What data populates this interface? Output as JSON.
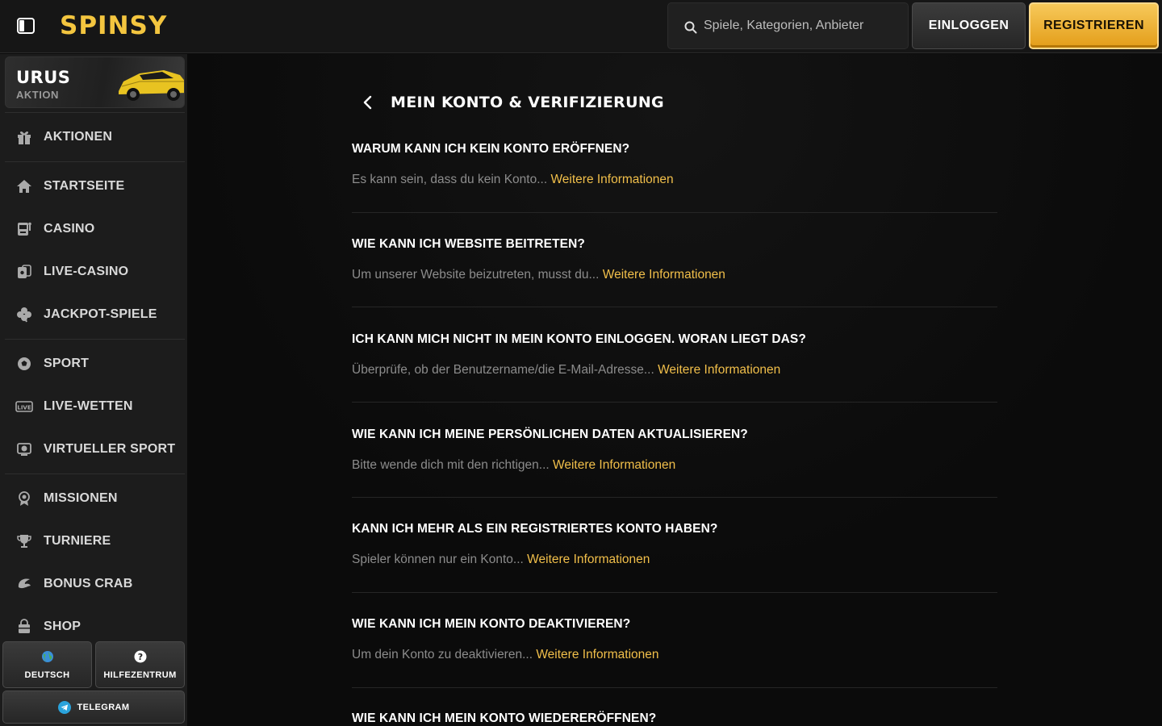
{
  "header": {
    "logo": "SPINSY",
    "search_placeholder": "Spiele, Kategorien, Anbieter",
    "login_label": "EINLOGGEN",
    "register_label": "REGISTRIEREN"
  },
  "sidebar": {
    "promo": {
      "title": "URUS",
      "subtitle": "AKTION"
    },
    "items": [
      {
        "label": "AKTIONEN",
        "icon": "gift-icon"
      },
      {
        "label": "STARTSEITE",
        "icon": "home-icon"
      },
      {
        "label": "CASINO",
        "icon": "slot-machine-icon"
      },
      {
        "label": "LIVE-CASINO",
        "icon": "cards-icon"
      },
      {
        "label": "JACKPOT-SPIELE",
        "icon": "clover-icon"
      },
      {
        "label": "SPORT",
        "icon": "soccer-ball-icon"
      },
      {
        "label": "LIVE-WETTEN",
        "icon": "live-badge-icon"
      },
      {
        "label": "VIRTUELLER SPORT",
        "icon": "virtual-sport-icon"
      },
      {
        "label": "MISSIONEN",
        "icon": "missions-icon"
      },
      {
        "label": "TURNIERE",
        "icon": "trophy-icon"
      },
      {
        "label": "BONUS CRAB",
        "icon": "crab-claw-icon"
      },
      {
        "label": "SHOP",
        "icon": "shop-bag-icon"
      }
    ],
    "language_label": "DEUTSCH",
    "help_label": "HILFEZENTRUM",
    "telegram_label": "TELEGRAM",
    "live_badge_text": "LIVE"
  },
  "main": {
    "title": "MEIN KONTO & VERIFIZIERUNG",
    "more_label": "Weitere Informationen",
    "faqs": [
      {
        "question": "WARUM KANN ICH KEIN KONTO ERÖFFNEN?",
        "answer": "Es kann sein, dass du kein Konto..."
      },
      {
        "question": "WIE KANN ICH WEBSITE BEITRETEN?",
        "answer": "Um unserer Website beizutreten, musst du..."
      },
      {
        "question": "ICH KANN MICH NICHT IN MEIN KONTO EINLOGGEN. WORAN LIEGT DAS?",
        "answer": "Überprüfe, ob der Benutzername/die E-Mail-Adresse..."
      },
      {
        "question": "WIE KANN ICH MEINE PERSÖNLICHEN DATEN AKTUALISIEREN?",
        "answer": "Bitte wende dich mit den richtigen..."
      },
      {
        "question": "KANN ICH MEHR ALS EIN REGISTRIERTES KONTO HABEN?",
        "answer": "Spieler können nur ein Konto..."
      },
      {
        "question": "WIE KANN ICH MEIN KONTO DEAKTIVIEREN?",
        "answer": "Um dein Konto zu deaktivieren..."
      },
      {
        "question": "WIE KANN ICH MEIN KONTO WIEDERERÖFFNEN?",
        "answer": ""
      }
    ]
  },
  "colors": {
    "accent": "#f3c53f",
    "link": "#f1bf4a",
    "background": "#0b0b0b",
    "sidebar": "#1c1c1c"
  }
}
